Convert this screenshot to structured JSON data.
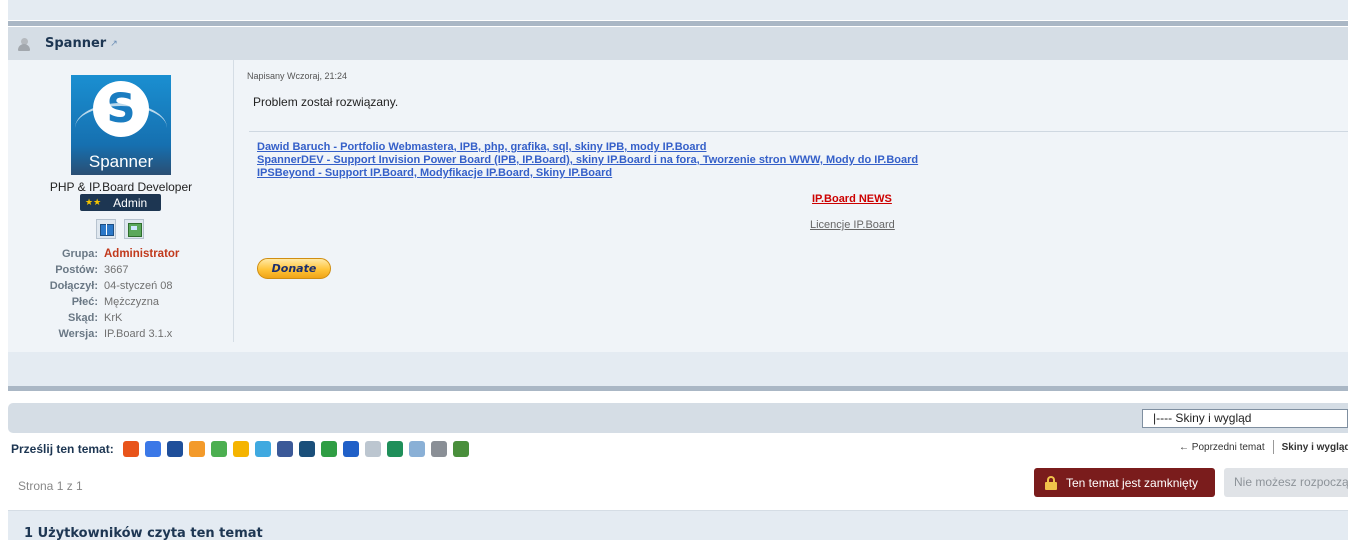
{
  "post": {
    "author": "Spanner",
    "avatar_text": "Spanner",
    "avatar_letter": "S",
    "member_title": "PHP & IP.Board Developer",
    "rank_stars": "★★",
    "rank_label": "Admin",
    "stats": [
      {
        "key": "Grupa:",
        "value": "Administrator"
      },
      {
        "key": "Postów:",
        "value": "3667"
      },
      {
        "key": "Dołączył:",
        "value": "04-styczeń 08"
      },
      {
        "key": "Płeć:",
        "value": "Mężczyzna"
      },
      {
        "key": "Skąd:",
        "value": "KrK"
      },
      {
        "key": "Wersja:",
        "value": "IP.Board 3.1.x"
      }
    ],
    "date": "Napisany Wczoraj, 21:24",
    "text": "Problem został rozwiązany.",
    "signature_links": [
      "Dawid Baruch - Portfolio Webmastera, IPB, php, grafika, sql, skiny IPB, mody IP.Board",
      "SpannerDEV - Support Invision Power Board (IPB, IP.Board), skiny IP.Board i na fora, Tworzenie stron WWW, Mody do IP.Board",
      "IPSBeyond - Support IP.Board, Modyfikacje IP.Board, Skiny IP.Board"
    ],
    "news_link": "IP.Board NEWS",
    "licence_link": "Licencje IP.Board",
    "donate_label": "Donate"
  },
  "jump": {
    "selected": "|---- Skiny i wygląd"
  },
  "share": {
    "label": "Prześlij ten temat:",
    "icons": [
      {
        "name": "blip-icon",
        "color": "#e8541b"
      },
      {
        "name": "google-icon",
        "color": "#3b78e7"
      },
      {
        "name": "myspace-icon",
        "color": "#1f4f9a"
      },
      {
        "name": "wykop-icon",
        "color": "#f39a2a"
      },
      {
        "name": "windows-live-icon",
        "color": "#4caf50"
      },
      {
        "name": "digg-down-icon",
        "color": "#f5b400"
      },
      {
        "name": "twitter-icon",
        "color": "#3fa9e0"
      },
      {
        "name": "facebook-icon",
        "color": "#3b5998"
      },
      {
        "name": "digg-icon",
        "color": "#1a4f7a"
      },
      {
        "name": "globe-icon",
        "color": "#2f9e44"
      },
      {
        "name": "delicious-icon",
        "color": "#2060c8"
      },
      {
        "name": "reddit-icon",
        "color": "#bcc6d0"
      },
      {
        "name": "stumbleupon-icon",
        "color": "#1f8f5a"
      },
      {
        "name": "email-icon",
        "color": "#8ab0d6"
      },
      {
        "name": "print-icon",
        "color": "#8a8f96"
      },
      {
        "name": "download-icon",
        "color": "#4a8f3c"
      }
    ]
  },
  "nav": {
    "prev": "← Poprzedni temat",
    "next": "Skiny i wygląd"
  },
  "pagination": {
    "label": "Strona 1 z 1"
  },
  "buttons": {
    "locked": "Ten temat jest zamknięty",
    "disabled": "Nie możesz rozpocząć"
  },
  "readers": {
    "title": "1 Użytkowników czyta ten temat"
  }
}
